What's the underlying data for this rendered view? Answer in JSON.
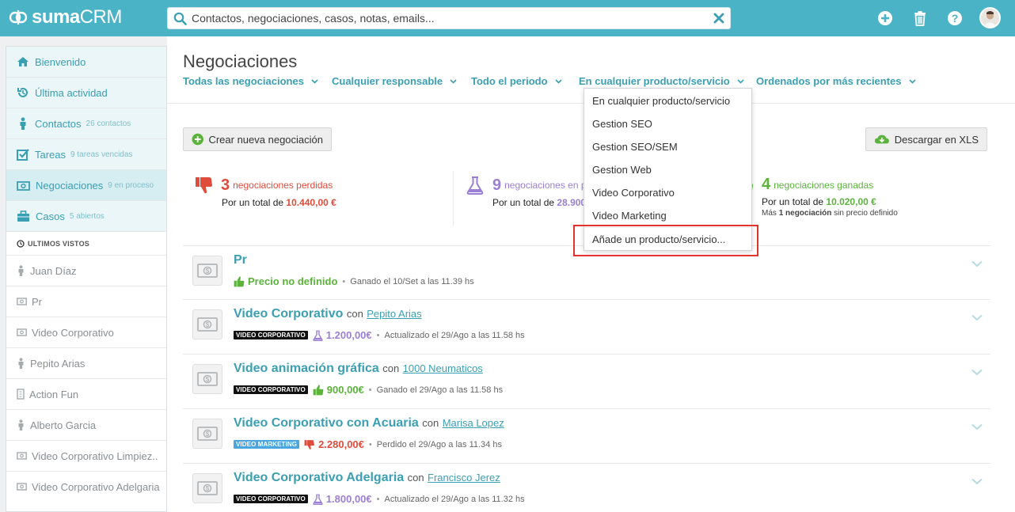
{
  "brand": {
    "name_main": "suma",
    "name_suffix": "CRM"
  },
  "search": {
    "placeholder": "Contactos, negociaciones, casos, notas, emails..."
  },
  "topbar_icons": [
    "plus-circle-icon",
    "trash-icon",
    "help-icon",
    "user-avatar"
  ],
  "sidebar": {
    "nav": [
      {
        "label": "Bienvenido",
        "meta": "",
        "icon": "home-icon"
      },
      {
        "label": "Última actividad",
        "meta": "",
        "icon": "history-icon"
      },
      {
        "label": "Contactos",
        "meta": "26 contactos",
        "icon": "person-icon"
      },
      {
        "label": "Tareas",
        "meta": "9 tareas vencidas",
        "icon": "checkbox-icon"
      },
      {
        "label": "Negociaciones",
        "meta": "9 en proceso",
        "icon": "money-icon"
      },
      {
        "label": "Casos",
        "meta": "5 abiertos",
        "icon": "briefcase-icon"
      }
    ],
    "recent_title": "ULTIMOS VISTOS",
    "recent": [
      {
        "label": "Juan Díaz",
        "icon": "person-icon"
      },
      {
        "label": "Pr",
        "icon": "money-icon"
      },
      {
        "label": "Video Corporativo",
        "icon": "money-icon"
      },
      {
        "label": "Pepito Arias",
        "icon": "person-icon"
      },
      {
        "label": "Action Fun",
        "icon": "building-icon"
      },
      {
        "label": "Alberto Garcia",
        "icon": "person-icon"
      },
      {
        "label": "Video Corporativo Limpiez..",
        "icon": "money-icon"
      },
      {
        "label": "Video Corporativo Adelgaria",
        "icon": "money-icon"
      }
    ]
  },
  "main": {
    "title": "Negociaciones",
    "filters": [
      "Todas las negociaciones",
      "Cualquier responsable",
      "Todo el periodo",
      "En cualquier producto/servicio",
      "Ordenados por más recientes"
    ],
    "create_button": "Crear nueva negociación",
    "download_button": "Descargar en XLS",
    "stats": {
      "lost": {
        "count": "3",
        "label": "negociaciones perdidas",
        "total_prefix": "Por un total de",
        "total": "10.440,00 €",
        "color": "#e04c3c"
      },
      "open": {
        "count": "9",
        "label": "negociaciones en p",
        "total_prefix": "Por un total de",
        "total": "28.900",
        "color": "#9b7fd4"
      },
      "won": {
        "count": "4",
        "label": "negociaciones ganadas",
        "total_prefix": "Por un total de",
        "total": "10.020,00 €",
        "note_pre": "Más",
        "note_num": "1",
        "note_bold": "negociación",
        "note_post": "sin precio definido",
        "color": "#5bb33c"
      }
    },
    "deals": [
      {
        "name": "Pr",
        "con": "",
        "contact": "",
        "badge": "",
        "status": "won",
        "price": "Precio no definido",
        "meta": "Ganado el 10/Set a las 11.39 hs"
      },
      {
        "name": "Video Corporativo",
        "con": "con",
        "contact": "Pepito Arias",
        "badge": "VIDEO CORPORATIVO",
        "status": "open",
        "price": "1.200,00€",
        "meta": "Actualizado el 29/Ago a las 11.58 hs"
      },
      {
        "name": "Video animación gráfica",
        "con": "con",
        "contact": "1000 Neumaticos",
        "badge": "VIDEO CORPORATIVO",
        "status": "won",
        "price": "900,00€",
        "meta": "Ganado el 29/Ago a las 11.58 hs"
      },
      {
        "name": "Video Corporativo con Acuaria",
        "con": "con",
        "contact": "Marisa Lopez",
        "badge": "VIDEO MARKETING",
        "status": "lost",
        "price": "2.280,00€",
        "meta": "Perdido el 29/Ago a las 11.34 hs"
      },
      {
        "name": "Video Corporativo Adelgaria",
        "con": "con",
        "contact": "Francisco Jerez",
        "badge": "VIDEO CORPORATIVO",
        "status": "open",
        "price": "1.800,00€",
        "meta": "Actualizado el 29/Ago a las 11.32 hs"
      }
    ]
  },
  "dropdown": {
    "items": [
      "En cualquier producto/servicio",
      "Gestion SEO",
      "Gestion SEO/SEM",
      "Gestion Web",
      "Video Corporativo",
      "Video Marketing"
    ],
    "add_label": "Añade un producto/servicio..."
  },
  "colors": {
    "topbar": "#4bb3c6",
    "link": "#3b9fb3",
    "lost": "#e04c3c",
    "open": "#9b7fd4",
    "won": "#5bb33c",
    "highlight": "#e4332a"
  }
}
